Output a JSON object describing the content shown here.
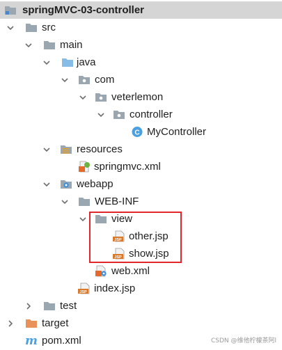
{
  "project": {
    "name": "springMVC-03-controller"
  },
  "tree": {
    "src": "src",
    "main": "main",
    "java": "java",
    "com": "com",
    "veterlemon": "veterlemon",
    "controller": "controller",
    "mycontroller": "MyController",
    "resources": "resources",
    "springmvc_xml": "springmvc.xml",
    "webapp": "webapp",
    "web_inf": "WEB-INF",
    "view": "view",
    "other_jsp": "other.jsp",
    "show_jsp": "show.jsp",
    "web_xml": "web.xml",
    "index_jsp": "index.jsp",
    "test": "test",
    "target": "target",
    "pom_xml": "pom.xml"
  },
  "icons": {
    "jsp_badge": "JSP",
    "class_badge": "C",
    "maven_badge": "m"
  },
  "colors": {
    "folder": "#9aa7b0",
    "source_folder": "#87bce6",
    "target_folder": "#e8925a",
    "jsp": "#d9792a",
    "class_icon": "#4aa0e0",
    "highlight": "#e0262a"
  },
  "watermark": "CSDN @维他柠檬茶阿l"
}
